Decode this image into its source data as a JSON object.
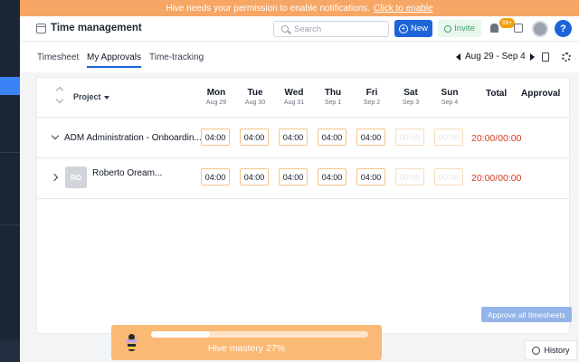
{
  "notification": {
    "message": "Hive needs your permission to enable notifications.",
    "link": "Click to enable"
  },
  "header": {
    "title": "Time management",
    "search_placeholder": "Search",
    "new_label": "New",
    "invite_label": "Invite",
    "notification_badge": "99+",
    "help_label": "?"
  },
  "tabs": [
    {
      "label": "Timesheet",
      "active": false
    },
    {
      "label": "My Approvals",
      "active": true
    },
    {
      "label": "Time-tracking",
      "active": false
    }
  ],
  "week_range": "Aug 29 - Sep 4",
  "table": {
    "project_header": "Project",
    "total_header": "Total",
    "approval_header": "Approval",
    "days": [
      {
        "day": "Mon",
        "date": "Aug 29"
      },
      {
        "day": "Tue",
        "date": "Aug 30"
      },
      {
        "day": "Wed",
        "date": "Aug 31"
      },
      {
        "day": "Thu",
        "date": "Sep 1"
      },
      {
        "day": "Fri",
        "date": "Sep 2"
      },
      {
        "day": "Sat",
        "date": "Sep 3"
      },
      {
        "day": "Sun",
        "date": "Sep 4"
      }
    ],
    "rows": [
      {
        "title": "ADM Administration - Onboardin...",
        "values": [
          "04:00",
          "04:00",
          "04:00",
          "04:00",
          "04:00",
          "00:00",
          "00:00"
        ],
        "total": "20:00/00:00"
      },
      {
        "avatar": "RO",
        "title": "Roberto Oream...",
        "values": [
          "04:00",
          "04:00",
          "04:00",
          "04:00",
          "04:00",
          "00:00",
          "00:00"
        ],
        "total": "20:00/00:00"
      }
    ]
  },
  "approve_all_label": "Approve all timesheets",
  "mastery": {
    "label": "Hive mastery 27%",
    "progress": 0.27
  },
  "history_label": "History",
  "colors": {
    "accent": "#1d64d8",
    "notification": "#f6a765",
    "total_text": "#d63a1e",
    "mastery_bg": "#fbb976"
  }
}
